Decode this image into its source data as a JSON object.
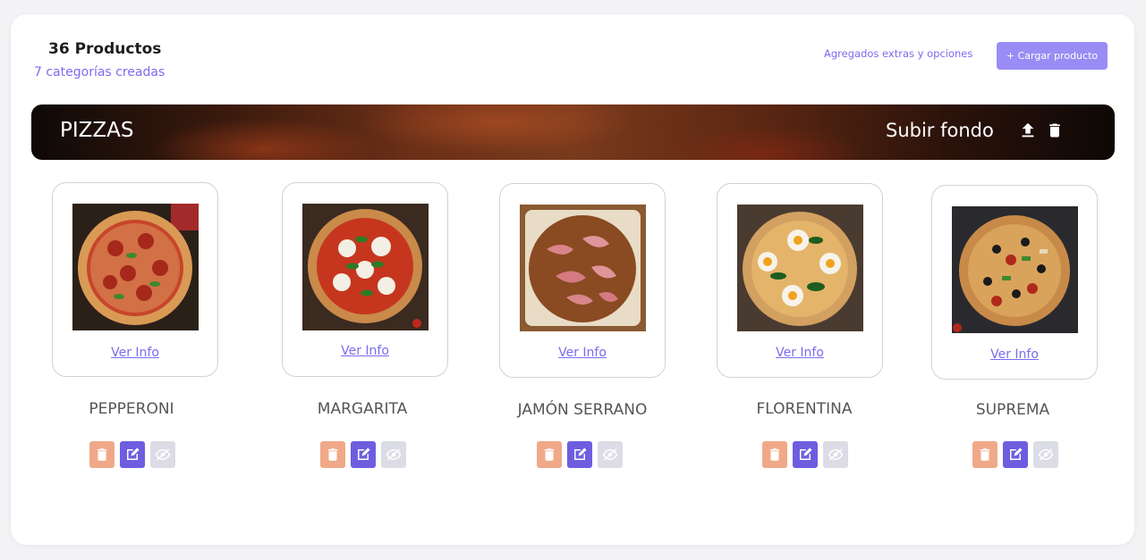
{
  "header": {
    "product_count": "36 Productos",
    "categories_count": "7 categorías creadas",
    "extras_link": "Agregados extras y opciones",
    "upload_button": "+ Cargar producto"
  },
  "category": {
    "name": "PIZZAS",
    "upload_background_label": "Subir fondo"
  },
  "products": [
    {
      "name": "PEPPERONI",
      "info_link": "Ver Info"
    },
    {
      "name": "MARGARITA",
      "info_link": "Ver Info"
    },
    {
      "name": "JAMÓN SERRANO",
      "info_link": "Ver Info"
    },
    {
      "name": "FLORENTINA",
      "info_link": "Ver Info"
    },
    {
      "name": "SUPREMA",
      "info_link": "Ver Info"
    }
  ],
  "colors": {
    "accent": "#7a6cf0",
    "delete": "#f0a988",
    "edit": "#6f5de0",
    "hide": "#dcdce6"
  },
  "icons": {
    "banner_upload": "upload-icon",
    "banner_delete": "trash-icon",
    "product_delete": "trash-icon",
    "product_edit": "edit-icon",
    "product_hide": "eye-off-icon"
  }
}
